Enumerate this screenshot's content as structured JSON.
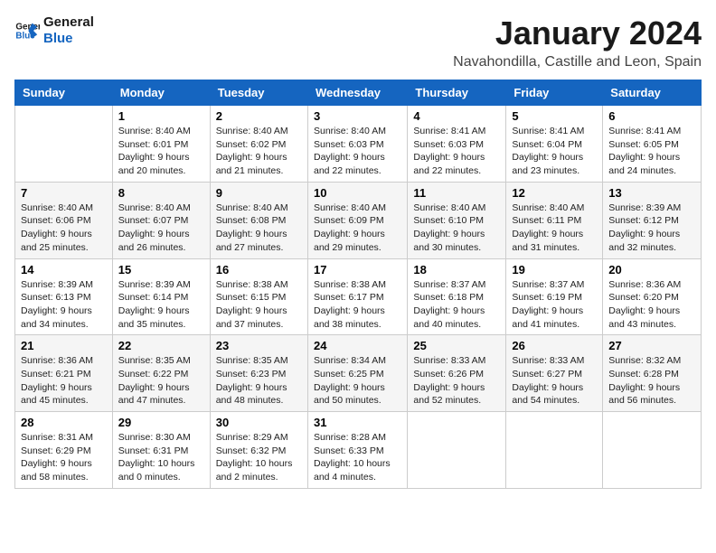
{
  "logo": {
    "line1": "General",
    "line2": "Blue"
  },
  "title": "January 2024",
  "location": "Navahondilla, Castille and Leon, Spain",
  "days_of_week": [
    "Sunday",
    "Monday",
    "Tuesday",
    "Wednesday",
    "Thursday",
    "Friday",
    "Saturday"
  ],
  "weeks": [
    [
      {
        "day": "",
        "info": ""
      },
      {
        "day": "1",
        "info": "Sunrise: 8:40 AM\nSunset: 6:01 PM\nDaylight: 9 hours\nand 20 minutes."
      },
      {
        "day": "2",
        "info": "Sunrise: 8:40 AM\nSunset: 6:02 PM\nDaylight: 9 hours\nand 21 minutes."
      },
      {
        "day": "3",
        "info": "Sunrise: 8:40 AM\nSunset: 6:03 PM\nDaylight: 9 hours\nand 22 minutes."
      },
      {
        "day": "4",
        "info": "Sunrise: 8:41 AM\nSunset: 6:03 PM\nDaylight: 9 hours\nand 22 minutes."
      },
      {
        "day": "5",
        "info": "Sunrise: 8:41 AM\nSunset: 6:04 PM\nDaylight: 9 hours\nand 23 minutes."
      },
      {
        "day": "6",
        "info": "Sunrise: 8:41 AM\nSunset: 6:05 PM\nDaylight: 9 hours\nand 24 minutes."
      }
    ],
    [
      {
        "day": "7",
        "info": "Sunrise: 8:40 AM\nSunset: 6:06 PM\nDaylight: 9 hours\nand 25 minutes."
      },
      {
        "day": "8",
        "info": "Sunrise: 8:40 AM\nSunset: 6:07 PM\nDaylight: 9 hours\nand 26 minutes."
      },
      {
        "day": "9",
        "info": "Sunrise: 8:40 AM\nSunset: 6:08 PM\nDaylight: 9 hours\nand 27 minutes."
      },
      {
        "day": "10",
        "info": "Sunrise: 8:40 AM\nSunset: 6:09 PM\nDaylight: 9 hours\nand 29 minutes."
      },
      {
        "day": "11",
        "info": "Sunrise: 8:40 AM\nSunset: 6:10 PM\nDaylight: 9 hours\nand 30 minutes."
      },
      {
        "day": "12",
        "info": "Sunrise: 8:40 AM\nSunset: 6:11 PM\nDaylight: 9 hours\nand 31 minutes."
      },
      {
        "day": "13",
        "info": "Sunrise: 8:39 AM\nSunset: 6:12 PM\nDaylight: 9 hours\nand 32 minutes."
      }
    ],
    [
      {
        "day": "14",
        "info": "Sunrise: 8:39 AM\nSunset: 6:13 PM\nDaylight: 9 hours\nand 34 minutes."
      },
      {
        "day": "15",
        "info": "Sunrise: 8:39 AM\nSunset: 6:14 PM\nDaylight: 9 hours\nand 35 minutes."
      },
      {
        "day": "16",
        "info": "Sunrise: 8:38 AM\nSunset: 6:15 PM\nDaylight: 9 hours\nand 37 minutes."
      },
      {
        "day": "17",
        "info": "Sunrise: 8:38 AM\nSunset: 6:17 PM\nDaylight: 9 hours\nand 38 minutes."
      },
      {
        "day": "18",
        "info": "Sunrise: 8:37 AM\nSunset: 6:18 PM\nDaylight: 9 hours\nand 40 minutes."
      },
      {
        "day": "19",
        "info": "Sunrise: 8:37 AM\nSunset: 6:19 PM\nDaylight: 9 hours\nand 41 minutes."
      },
      {
        "day": "20",
        "info": "Sunrise: 8:36 AM\nSunset: 6:20 PM\nDaylight: 9 hours\nand 43 minutes."
      }
    ],
    [
      {
        "day": "21",
        "info": "Sunrise: 8:36 AM\nSunset: 6:21 PM\nDaylight: 9 hours\nand 45 minutes."
      },
      {
        "day": "22",
        "info": "Sunrise: 8:35 AM\nSunset: 6:22 PM\nDaylight: 9 hours\nand 47 minutes."
      },
      {
        "day": "23",
        "info": "Sunrise: 8:35 AM\nSunset: 6:23 PM\nDaylight: 9 hours\nand 48 minutes."
      },
      {
        "day": "24",
        "info": "Sunrise: 8:34 AM\nSunset: 6:25 PM\nDaylight: 9 hours\nand 50 minutes."
      },
      {
        "day": "25",
        "info": "Sunrise: 8:33 AM\nSunset: 6:26 PM\nDaylight: 9 hours\nand 52 minutes."
      },
      {
        "day": "26",
        "info": "Sunrise: 8:33 AM\nSunset: 6:27 PM\nDaylight: 9 hours\nand 54 minutes."
      },
      {
        "day": "27",
        "info": "Sunrise: 8:32 AM\nSunset: 6:28 PM\nDaylight: 9 hours\nand 56 minutes."
      }
    ],
    [
      {
        "day": "28",
        "info": "Sunrise: 8:31 AM\nSunset: 6:29 PM\nDaylight: 9 hours\nand 58 minutes."
      },
      {
        "day": "29",
        "info": "Sunrise: 8:30 AM\nSunset: 6:31 PM\nDaylight: 10 hours\nand 0 minutes."
      },
      {
        "day": "30",
        "info": "Sunrise: 8:29 AM\nSunset: 6:32 PM\nDaylight: 10 hours\nand 2 minutes."
      },
      {
        "day": "31",
        "info": "Sunrise: 8:28 AM\nSunset: 6:33 PM\nDaylight: 10 hours\nand 4 minutes."
      },
      {
        "day": "",
        "info": ""
      },
      {
        "day": "",
        "info": ""
      },
      {
        "day": "",
        "info": ""
      }
    ]
  ]
}
